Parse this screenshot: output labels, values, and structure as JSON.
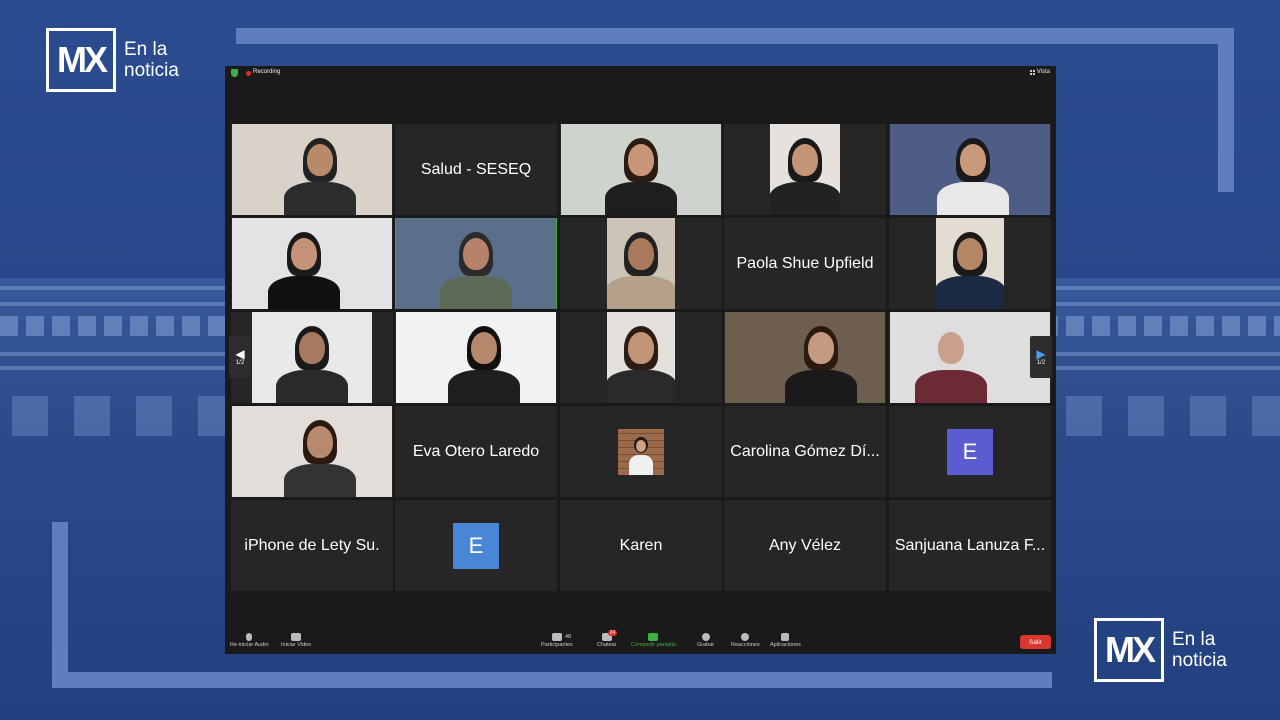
{
  "brand": {
    "logo_text": "MX",
    "tagline_line1": "En la",
    "tagline_line2": "noticia"
  },
  "meeting": {
    "recording_label": "Recording",
    "view_label": "Vista",
    "page_indicator_left": "1/2",
    "page_indicator_right": "1/2"
  },
  "participants": [
    {
      "type": "video",
      "name": ""
    },
    {
      "type": "name",
      "name": "Salud - SESEQ"
    },
    {
      "type": "video",
      "name": ""
    },
    {
      "type": "video",
      "name": ""
    },
    {
      "type": "video",
      "name": ""
    },
    {
      "type": "video",
      "name": ""
    },
    {
      "type": "video",
      "name": "",
      "active": true
    },
    {
      "type": "video",
      "name": ""
    },
    {
      "type": "name",
      "name": "Paola Shue Upfield"
    },
    {
      "type": "video",
      "name": ""
    },
    {
      "type": "video",
      "name": ""
    },
    {
      "type": "video",
      "name": ""
    },
    {
      "type": "video",
      "name": ""
    },
    {
      "type": "video",
      "name": ""
    },
    {
      "type": "video",
      "name": ""
    },
    {
      "type": "video",
      "name": ""
    },
    {
      "type": "name",
      "name": "Eva Otero Laredo"
    },
    {
      "type": "photo",
      "name": ""
    },
    {
      "type": "name",
      "name": "Carolina Gómez Dí..."
    },
    {
      "type": "avatar",
      "name": "E",
      "color": "#5b5ccf"
    },
    {
      "type": "name",
      "name": "iPhone de Lety Su."
    },
    {
      "type": "avatar",
      "name": "E",
      "color": "#4a86d6"
    },
    {
      "type": "name",
      "name": "Karen"
    },
    {
      "type": "name",
      "name": "Any Vélez"
    },
    {
      "type": "name",
      "name": "Sanjuana Lanuza F..."
    }
  ],
  "toolbar": {
    "audio_label": "Re-iniciar Audio",
    "video_label": "Iniciar Video",
    "participants_label": "Participantes",
    "participants_count": "48",
    "chat_label": "Chatear",
    "chat_badge": "24",
    "share_label": "Compartir pantalla",
    "record_label": "Grabar",
    "reactions_label": "Reacciones",
    "apps_label": "Aplicaciones",
    "leave_label": "Salir"
  },
  "colors": {
    "background": "#2b4c8f",
    "zoom_bg": "#1a1a1a",
    "tile_bg": "#262626",
    "active_speaker": "#3faa3f",
    "leave_button": "#d9372f",
    "share_green": "#3cb043"
  }
}
